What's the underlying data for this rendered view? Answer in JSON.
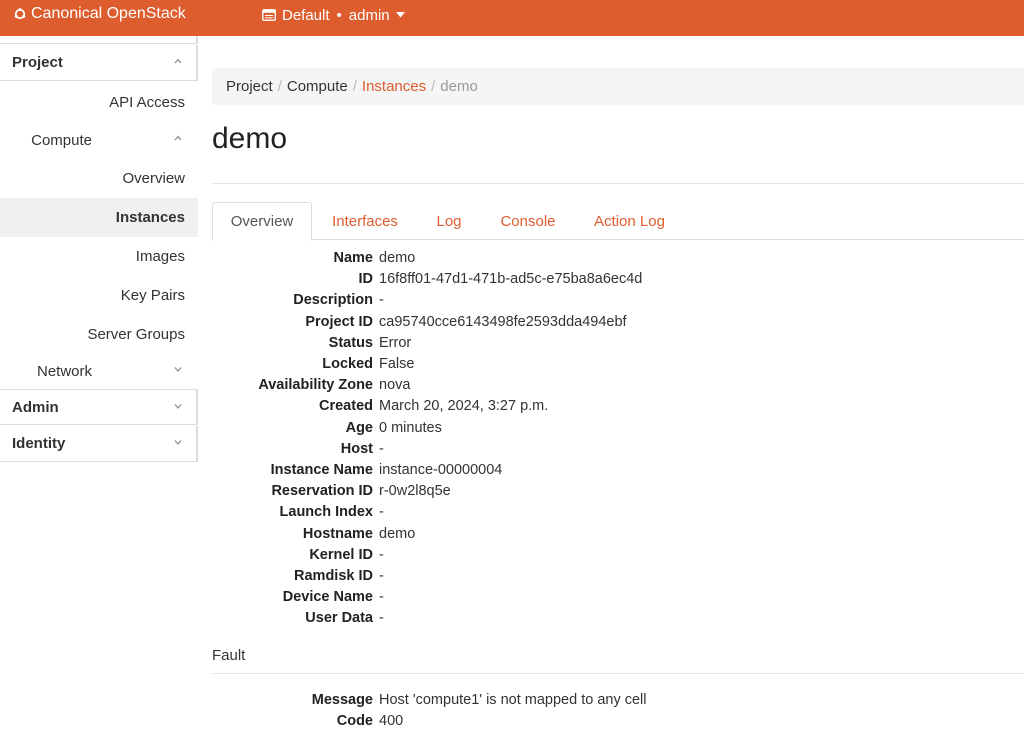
{
  "header": {
    "brand": "Canonical OpenStack",
    "project_domain": "Default",
    "project_user": "admin",
    "accent_color": "#dd5d2e"
  },
  "sidebar": {
    "sections": [
      {
        "label": "Project"
      },
      {
        "label": "Admin"
      },
      {
        "label": "Identity"
      }
    ],
    "items": [
      {
        "label": "API Access"
      },
      {
        "label": "Compute"
      },
      {
        "label": "Overview"
      },
      {
        "label": "Instances"
      },
      {
        "label": "Images"
      },
      {
        "label": "Key Pairs"
      },
      {
        "label": "Server Groups"
      },
      {
        "label": "Network"
      }
    ]
  },
  "breadcrumb": [
    "Project",
    "Compute",
    "Instances",
    "demo"
  ],
  "page": {
    "title": "demo"
  },
  "tabs": [
    "Overview",
    "Interfaces",
    "Log",
    "Console",
    "Action Log"
  ],
  "overview": [
    {
      "label": "Name",
      "value": "demo"
    },
    {
      "label": "ID",
      "value": "16f8ff01-47d1-471b-ad5c-e75ba8a6ec4d"
    },
    {
      "label": "Description",
      "value": "-"
    },
    {
      "label": "Project ID",
      "value": "ca95740cce6143498fe2593dda494ebf"
    },
    {
      "label": "Status",
      "value": "Error"
    },
    {
      "label": "Locked",
      "value": "False"
    },
    {
      "label": "Availability Zone",
      "value": "nova"
    },
    {
      "label": "Created",
      "value": "March 20, 2024, 3:27 p.m."
    },
    {
      "label": "Age",
      "value": "0 minutes"
    },
    {
      "label": "Host",
      "value": "-"
    },
    {
      "label": "Instance Name",
      "value": "instance-00000004"
    },
    {
      "label": "Reservation ID",
      "value": "r-0w2l8q5e"
    },
    {
      "label": "Launch Index",
      "value": "-"
    },
    {
      "label": "Hostname",
      "value": "demo"
    },
    {
      "label": "Kernel ID",
      "value": "-"
    },
    {
      "label": "Ramdisk ID",
      "value": "-"
    },
    {
      "label": "Device Name",
      "value": "-"
    },
    {
      "label": "User Data",
      "value": "-"
    }
  ],
  "fault": {
    "title": "Fault",
    "rows": [
      {
        "label": "Message",
        "value": "Host 'compute1' is not mapped to any cell"
      },
      {
        "label": "Code",
        "value": "400"
      }
    ]
  }
}
